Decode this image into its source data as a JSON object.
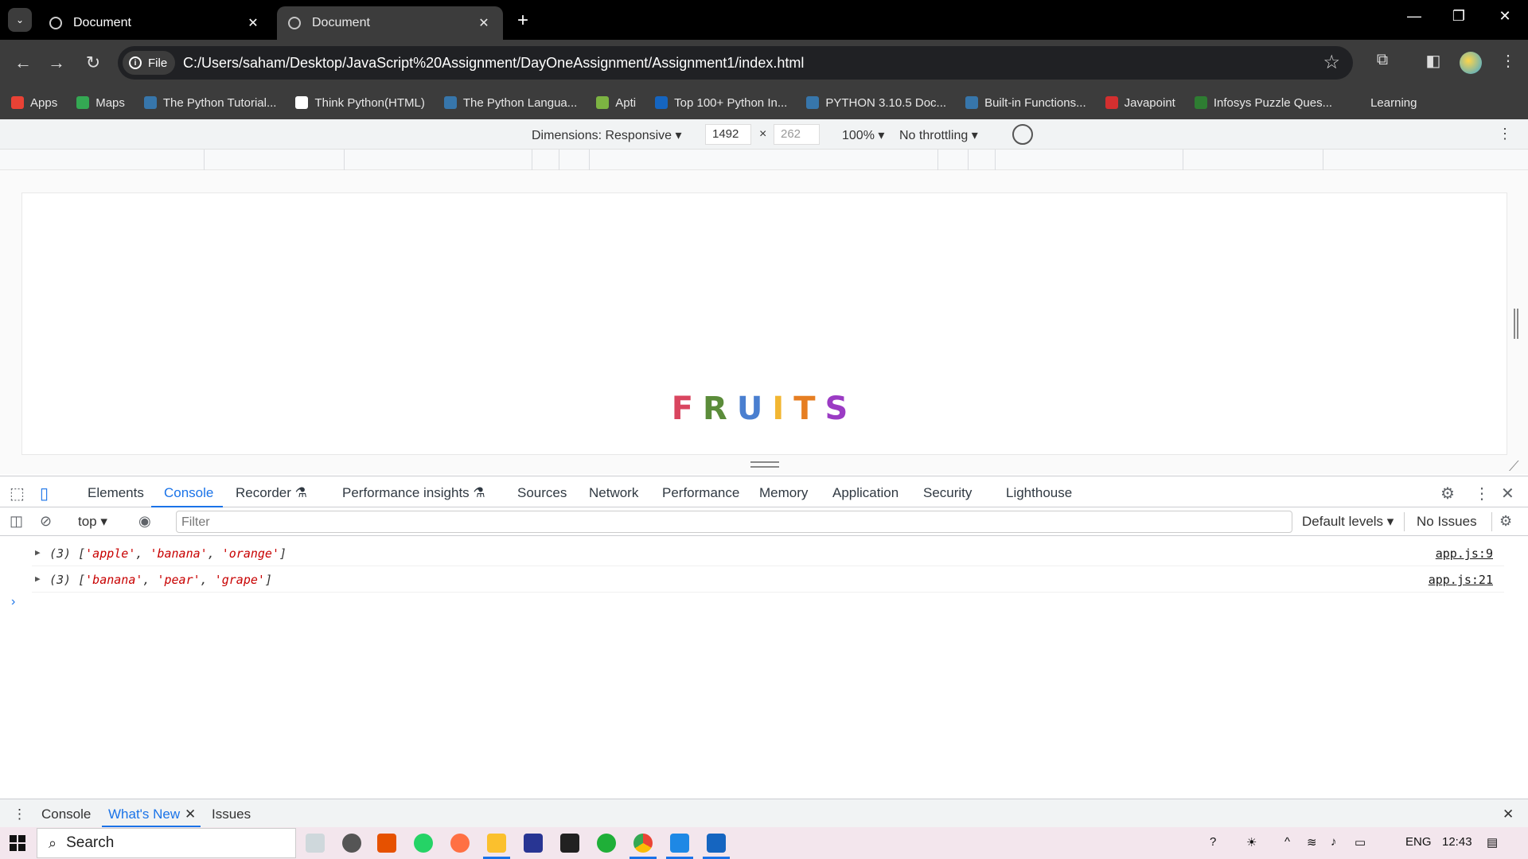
{
  "browser": {
    "tabs": [
      {
        "label": "Document",
        "close": "✕"
      },
      {
        "label": "Document",
        "close": "✕"
      }
    ],
    "new_tab": "+",
    "window_controls": {
      "minimize": "—",
      "restore": "❐",
      "close": "✕"
    },
    "url_chip": "File",
    "url": "C:/Users/saham/Desktop/JavaScript%20Assignment/DayOneAssignment/Assignment1/index.html"
  },
  "bookmarks": [
    {
      "label": "Apps",
      "color": "#e94235"
    },
    {
      "label": "Maps",
      "color": "#34a853"
    },
    {
      "label": "The Python Tutorial...",
      "color": "#3776ab"
    },
    {
      "label": "Think Python(HTML)",
      "color": "#ffffff"
    },
    {
      "label": "The Python Langua...",
      "color": "#3776ab"
    },
    {
      "label": "Apti",
      "color": "#7cb342"
    },
    {
      "label": "Top 100+ Python In...",
      "color": "#1565c0"
    },
    {
      "label": "PYTHON 3.10.5 Doc...",
      "color": "#3776ab"
    },
    {
      "label": "Built-in Functions...",
      "color": "#3776ab"
    },
    {
      "label": "Javapoint",
      "color": "#d32f2f"
    },
    {
      "label": "Infosys Puzzle Ques...",
      "color": "#2e7d32"
    },
    {
      "label": "Learning",
      "color": "#3c3c3c"
    }
  ],
  "device_toolbar": {
    "dimensions": "Dimensions: Responsive ▾",
    "width": "1492",
    "times": "×",
    "height_placeholder": "262",
    "zoom": "100% ▾",
    "throttling": "No throttling ▾"
  },
  "page": {
    "title_letters": [
      {
        "ch": "F",
        "color": "#d9455f"
      },
      {
        "ch": "R",
        "color": "#5b8c3a"
      },
      {
        "ch": "U",
        "color": "#4a7fd0"
      },
      {
        "ch": "I",
        "color": "#f2b632"
      },
      {
        "ch": "T",
        "color": "#e67e22"
      },
      {
        "ch": "S",
        "color": "#9b3bc4"
      }
    ]
  },
  "devtools": {
    "tabs": [
      "Elements",
      "Console",
      "Recorder ⚗",
      "Performance insights ⚗",
      "Sources",
      "Network",
      "Performance",
      "Memory",
      "Application",
      "Security",
      "Lighthouse"
    ],
    "context": "top ▾",
    "filter_placeholder": "Filter",
    "levels": "Default levels ▾",
    "issues": "No Issues"
  },
  "console": {
    "messages": [
      {
        "count": "(3) [",
        "items": [
          "'apple'",
          "'banana'",
          "'orange'"
        ],
        "close": "]",
        "source": "app.js:9"
      },
      {
        "count": "(3) [",
        "items": [
          "'banana'",
          "'pear'",
          "'grape'"
        ],
        "close": "]",
        "source": "app.js:21"
      }
    ],
    "prompt": "›"
  },
  "drawer": {
    "tabs": [
      "Console",
      "What's New",
      "Issues"
    ],
    "close": "✕"
  },
  "taskbar": {
    "search": "Search",
    "language": "ENG",
    "time": "12:43"
  }
}
